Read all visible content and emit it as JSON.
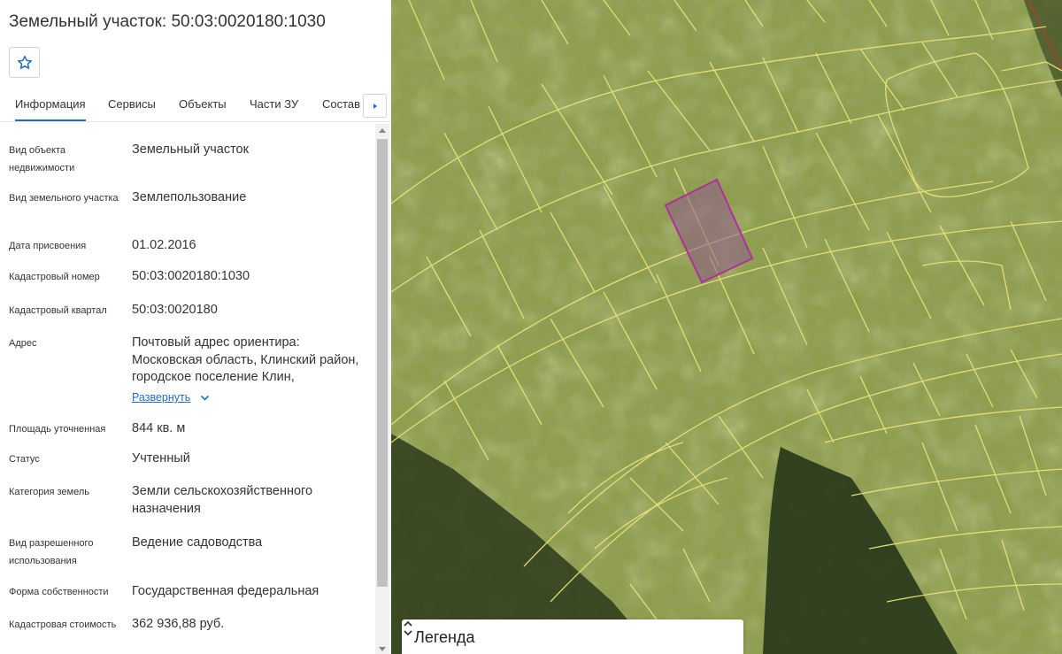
{
  "panel": {
    "title": "Земельный участок: 50:03:0020180:1030",
    "favorite_icon": "star-outline-icon"
  },
  "tabs": [
    {
      "label": "Информация",
      "active": true
    },
    {
      "label": "Сервисы",
      "active": false
    },
    {
      "label": "Объекты",
      "active": false
    },
    {
      "label": "Части ЗУ",
      "active": false
    },
    {
      "label": "Состав",
      "active": false
    }
  ],
  "tabs_more_icon": "triangle-right-icon",
  "fields": [
    {
      "label": "Вид объекта недвижимости",
      "value": "Земельный участок"
    },
    {
      "label": "Вид земельного участка",
      "value": "Землепользование"
    },
    {
      "label": "Дата присвоения",
      "value": "01.02.2016"
    },
    {
      "label": "Кадастровый номер",
      "value": "50:03:0020180:1030"
    },
    {
      "label": "Кадастровый квартал",
      "value": "50:03:0020180"
    },
    {
      "label": "Адрес",
      "value": "Почтовый адрес ориентира: Московская область, Клинский район, городское поселение Клин,",
      "expand_label": "Развернуть"
    },
    {
      "label": "Площадь уточненная",
      "value": "844 кв. м"
    },
    {
      "label": "Статус",
      "value": "Учтенный"
    },
    {
      "label": "Категория земель",
      "value": "Земли сельскохозяйственного назначения"
    },
    {
      "label": "Вид разрешенного использования",
      "value": "Ведение садоводства"
    },
    {
      "label": "Форма собственности",
      "value": "Государственная федеральная"
    },
    {
      "label": "Кадастровая стоимость",
      "value": "362 936,88 руб."
    }
  ],
  "legend": {
    "title": "Легенда",
    "toggle_icon": "chevron-up-down-icon"
  },
  "colors": {
    "accent": "#1f6fc5",
    "parcel_outline": "#e8e27a",
    "selected_parcel": "#b0309a"
  }
}
